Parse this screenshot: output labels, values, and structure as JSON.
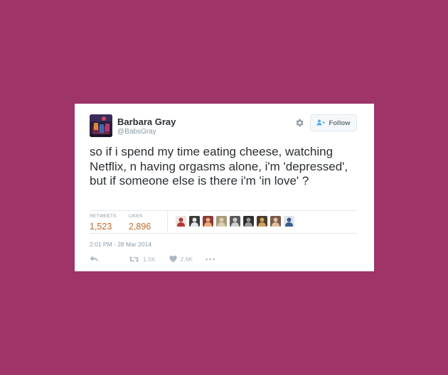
{
  "colors": {
    "background": "#9e3467",
    "card": "#ffffff",
    "stat_value": "#bd6a2a",
    "muted": "#8899a6"
  },
  "tweet": {
    "author_name": "Barbara Gray",
    "author_handle": "@BabsGray",
    "follow_label": "Follow",
    "text": "so if i spend my time eating cheese, watching Netflix, n having orgasms alone, i'm 'depressed', but if someone else is there i'm 'in love' ?",
    "retweets_label": "RETWEETS",
    "retweets_count": "1,523",
    "likes_label": "LIKES",
    "likes_count": "2,896",
    "timestamp": "2:01 PM - 28 Mar 2014",
    "retweet_action_count": "1.5K",
    "like_action_count": "2.9K"
  },
  "icons": {
    "settings": "gear-icon",
    "follow": "add-user-icon",
    "reply": "reply-icon",
    "retweet": "retweet-icon",
    "like": "heart-icon",
    "more": "more-icon"
  },
  "likers": [
    {
      "name": "liker-1",
      "bg": "#f0e6e0",
      "fg": "#b23a3a"
    },
    {
      "name": "liker-2",
      "bg": "#3a3a3a",
      "fg": "#e6e6e6"
    },
    {
      "name": "liker-3",
      "bg": "#8c3a3a",
      "fg": "#e8b07a"
    },
    {
      "name": "liker-4",
      "bg": "#a89a78",
      "fg": "#d8cfb4"
    },
    {
      "name": "liker-5",
      "bg": "#5a5a5a",
      "fg": "#cfcfcf"
    },
    {
      "name": "liker-6",
      "bg": "#2e2e2e",
      "fg": "#9a9a9a"
    },
    {
      "name": "liker-7",
      "bg": "#4a3a2a",
      "fg": "#d0a060"
    },
    {
      "name": "liker-8",
      "bg": "#7a5a4a",
      "fg": "#e0c0a0"
    },
    {
      "name": "liker-9",
      "bg": "#dfe6ee",
      "fg": "#3a5a8a"
    }
  ]
}
